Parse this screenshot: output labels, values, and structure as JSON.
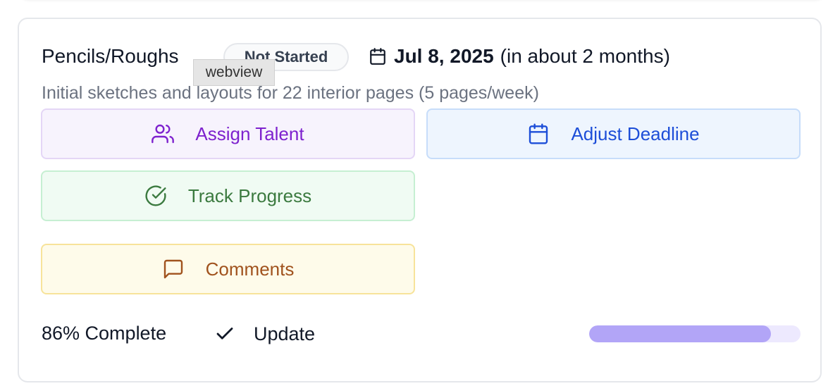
{
  "task": {
    "title": "Pencils/Roughs",
    "status": "Not Started",
    "due_date": "Jul 8, 2025",
    "due_relative": "(in about 2 months)",
    "description": "Initial sketches and layouts for 22 interior pages (5 pages/week)"
  },
  "tooltip": {
    "text": "webview"
  },
  "actions": {
    "assign_label": "Assign Talent",
    "deadline_label": "Adjust Deadline",
    "track_label": "Track Progress",
    "comments_label": "Comments"
  },
  "progress": {
    "label": "86% Complete",
    "percent": 86,
    "update_label": "Update"
  },
  "icons": {
    "assign": "users-icon",
    "deadline": "calendar-icon",
    "track": "check-circle-icon",
    "comments": "message-square-icon",
    "date": "calendar-icon",
    "update": "check-icon"
  },
  "colors": {
    "assign_text": "#7e22ce",
    "deadline_text": "#1d4ed8",
    "track_text": "#3b7a3f",
    "comments_text": "#a0521d",
    "progress_fill": "#b2a5f7"
  }
}
